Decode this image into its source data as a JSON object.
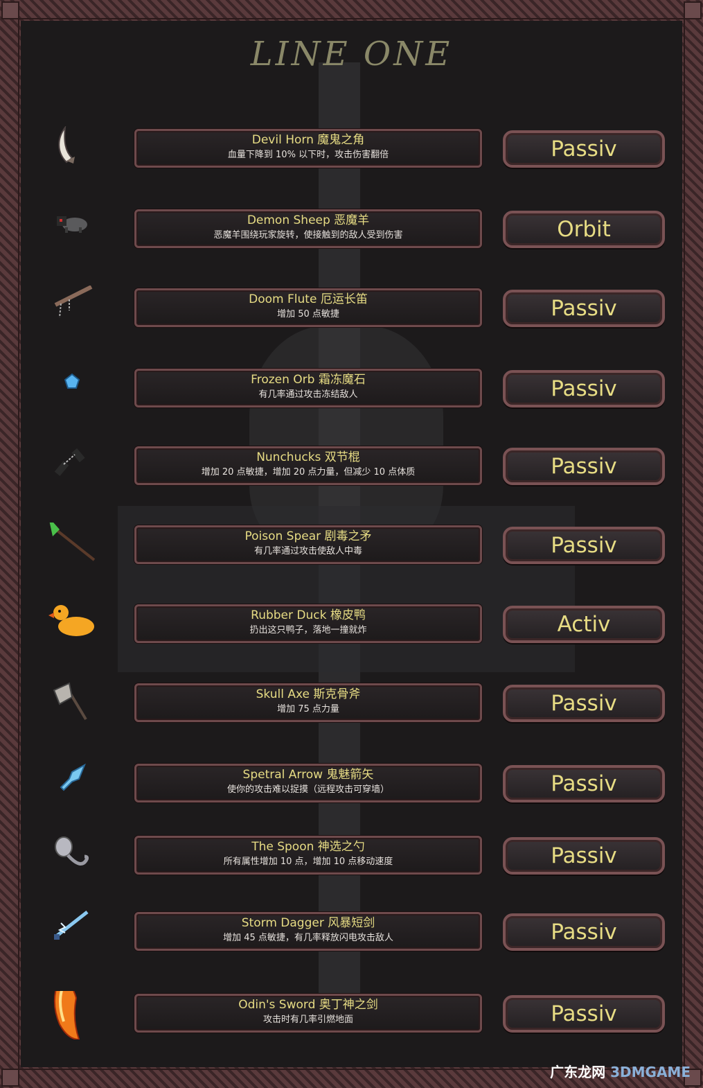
{
  "title": "LINE ONE",
  "items": [
    {
      "name": "Devil Horn 魔鬼之角",
      "desc": "血量下降到 10% 以下时，攻击伤害翻倍",
      "type": "Passiv",
      "icon": "horn-icon"
    },
    {
      "name": "Demon Sheep 恶魔羊",
      "desc": "恶魔羊围绕玩家旋转，使接触到的敌人受到伤害",
      "type": "Orbit",
      "icon": "sheep-icon"
    },
    {
      "name": "Doom Flute 厄运长笛",
      "desc": "增加 50 点敏捷",
      "type": "Passiv",
      "icon": "flute-icon"
    },
    {
      "name": "Frozen Orb 霜冻魔石",
      "desc": "有几率通过攻击冻结敌人",
      "type": "Passiv",
      "icon": "orb-icon"
    },
    {
      "name": "Nunchucks 双节棍",
      "desc": "增加 20 点敏捷，增加 20 点力量，但减少 10 点体质",
      "type": "Passiv",
      "icon": "nunchucks-icon"
    },
    {
      "name": "Poison Spear 剧毒之矛",
      "desc": "有几率通过攻击使敌人中毒",
      "type": "Passiv",
      "icon": "spear-icon"
    },
    {
      "name": "Rubber Duck 橡皮鸭",
      "desc": "扔出这只鸭子，落地一撞就炸",
      "type": "Activ",
      "icon": "duck-icon"
    },
    {
      "name": "Skull Axe 斯克骨斧",
      "desc": "增加 75 点力量",
      "type": "Passiv",
      "icon": "axe-icon"
    },
    {
      "name": "Spetral Arrow 鬼魅箭矢",
      "desc": "使你的攻击难以捉摸（远程攻击可穿墙）",
      "type": "Passiv",
      "icon": "arrow-icon"
    },
    {
      "name": "The Spoon 神选之勺",
      "desc": "所有属性增加 10 点，增加 10 点移动速度",
      "type": "Passiv",
      "icon": "spoon-icon"
    },
    {
      "name": "Storm Dagger 风暴短剑",
      "desc": "增加 45 点敏捷，有几率释放闪电攻击敌人",
      "type": "Passiv",
      "icon": "dagger-icon"
    },
    {
      "name": "Odin's Sword 奥丁神之剑",
      "desc": "攻击时有几率引燃地面",
      "type": "Passiv",
      "icon": "sword-icon"
    }
  ],
  "watermark": {
    "main": "广东龙网",
    "sub": "3DMGAME"
  }
}
